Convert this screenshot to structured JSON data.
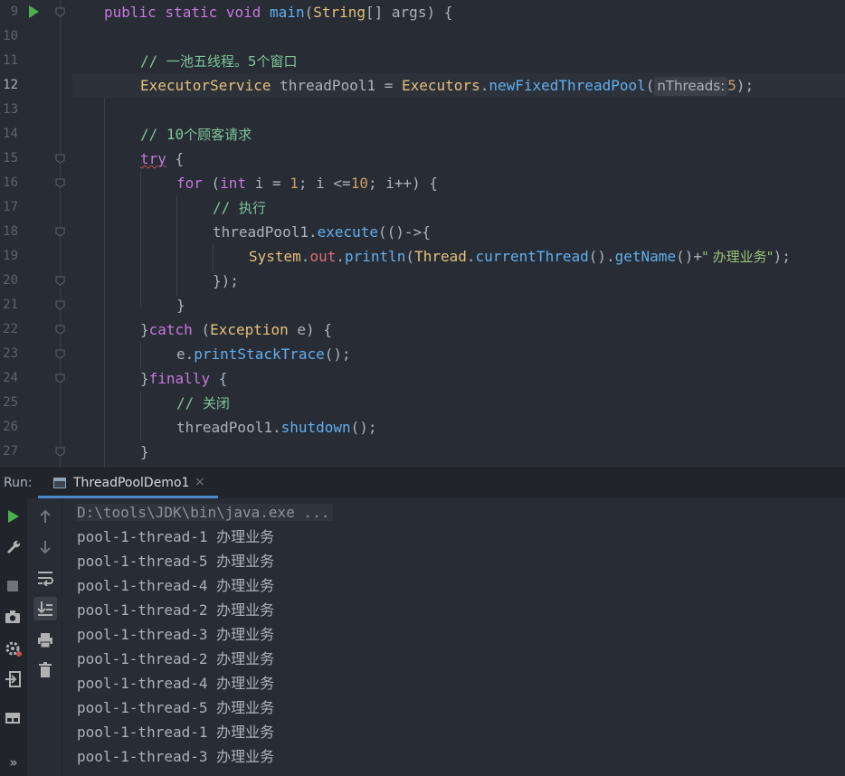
{
  "editor": {
    "line_numbers": [
      "9",
      "10",
      "11",
      "12",
      "13",
      "14",
      "15",
      "16",
      "17",
      "18",
      "19",
      "20",
      "21",
      "22",
      "23",
      "24",
      "25",
      "26",
      "27"
    ],
    "current_line": "12",
    "line9": {
      "kw1": "public",
      "kw2": "static",
      "kw3": "void",
      "fn": "main",
      "p1": "(",
      "type": "String",
      "p2": "[] args) {"
    },
    "line11": {
      "cm": "// ",
      "cm_cn": "一池五线程。5个窗口"
    },
    "line12": {
      "type1": "ExecutorService",
      "t1": " threadPool1 = ",
      "type2": "Executors",
      "dot": ".",
      "fn": "newFixedThreadPool",
      "p1": "(",
      "hint": "nThreads:",
      "num": "5",
      "p2": ");"
    },
    "line14": {
      "cm": "// 10",
      "cm_cn": "个顾客请求"
    },
    "line15": {
      "kw": "try",
      "p": " {"
    },
    "line16": {
      "kw": "for",
      "p1": " (",
      "kw2": "int",
      "p2": " i = ",
      "num1": "1",
      "p3": "; i <=",
      "num2": "10",
      "p4": "; i++) {"
    },
    "line17": {
      "cm": "// ",
      "cm_cn": "执行"
    },
    "line18": {
      "t1": "threadPool1.",
      "fn": "execute",
      "p": "(()->{"
    },
    "line19": {
      "type": "System",
      "dot": ".",
      "fld": "out",
      "dot2": ".",
      "fn": "println",
      "p1": "(",
      "type2": "Thread",
      "dot3": ".",
      "fn2": "currentThread",
      "p2": "().",
      "fn3": "getName",
      "p3": "()+",
      "str": "\" 办理业务\"",
      "p4": ");"
    },
    "line20": {
      "p": "});"
    },
    "line21": {
      "p": "}"
    },
    "line22": {
      "p1": "}",
      "kw": "catch",
      "p2": " (",
      "type": "Exception",
      "p3": " e) {"
    },
    "line23": {
      "t1": "e.",
      "fn": "printStackTrace",
      "p": "();"
    },
    "line24": {
      "p1": "}",
      "kw": "finally",
      "p2": " {"
    },
    "line25": {
      "cm": "// ",
      "cm_cn": "关闭"
    },
    "line26": {
      "t1": "threadPool1.",
      "fn": "shutdown",
      "p": "();"
    },
    "line27": {
      "p": "}"
    }
  },
  "run_panel": {
    "label": "Run:",
    "tab_label": "ThreadPoolDemo1",
    "tab_close": "×",
    "command": "D:\\tools\\JDK\\bin\\java.exe ...",
    "output": [
      {
        "thread": "pool-1-thread-1",
        "msg": "办理业务"
      },
      {
        "thread": "pool-1-thread-5",
        "msg": "办理业务"
      },
      {
        "thread": "pool-1-thread-4",
        "msg": "办理业务"
      },
      {
        "thread": "pool-1-thread-2",
        "msg": "办理业务"
      },
      {
        "thread": "pool-1-thread-3",
        "msg": "办理业务"
      },
      {
        "thread": "pool-1-thread-2",
        "msg": "办理业务"
      },
      {
        "thread": "pool-1-thread-4",
        "msg": "办理业务"
      },
      {
        "thread": "pool-1-thread-5",
        "msg": "办理业务"
      },
      {
        "thread": "pool-1-thread-1",
        "msg": "办理业务"
      },
      {
        "thread": "pool-1-thread-3",
        "msg": "办理业务"
      }
    ],
    "more_label": "»"
  },
  "icons": {
    "run": "play-icon",
    "wrench": "wrench-icon",
    "stop": "stop-icon",
    "camera": "camera-icon",
    "settings": "gear-icon",
    "login": "exit-icon",
    "layout": "layout-icon",
    "up": "arrow-up-icon",
    "down": "arrow-down-icon",
    "wrap": "soft-wrap-icon",
    "scroll": "scroll-to-end-icon",
    "print": "print-icon",
    "trash": "trash-icon"
  },
  "colors": {
    "accent": "#4a88c7",
    "run_green": "#4caf50",
    "background": "#282c34"
  }
}
